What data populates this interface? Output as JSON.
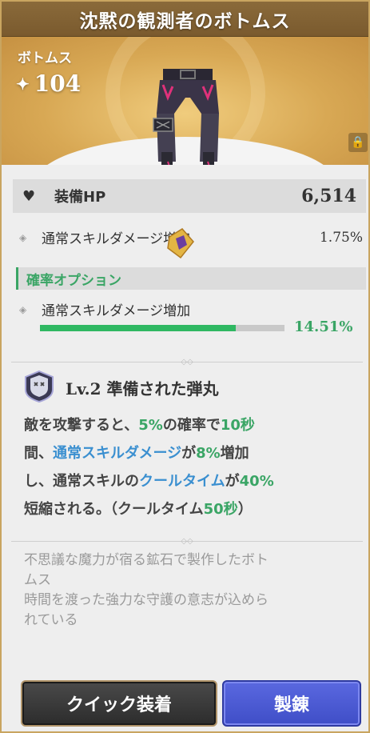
{
  "title": "沈黙の観測者のボトムス",
  "hero": {
    "item_type": "ボトムス",
    "level_icon": "sparkle-icon",
    "level": "104",
    "lock_icon": "lock-icon"
  },
  "main_stat": {
    "icon": "heart-icon",
    "label": "装備HP",
    "value": "6,514"
  },
  "sub_stat": {
    "label": "通常スキルダメージ増加",
    "value": "1.75%"
  },
  "probability_option": {
    "header": "確率オプション",
    "label": "通常スキルダメージ増加",
    "value": "14.51%",
    "bar_fill_fraction": 0.8,
    "bar_color": "#2fb862"
  },
  "skill": {
    "title": "Lv.2 準備された弾丸",
    "desc": {
      "l1a": "敵を攻撃すると、",
      "l1b": "5%",
      "l1c": "の確率で",
      "l1d": "10秒",
      "l2a": "間、",
      "l2b": "通常スキルダメージ",
      "l2c": "が",
      "l2d": "8%",
      "l2e": "増加",
      "l3a": "し、通常スキルの",
      "l3b": "クールタイム",
      "l3c": "が",
      "l3d": "40%",
      "l4a": "短縮される。（クールタイム",
      "l4b": "50秒",
      "l4c": "）"
    }
  },
  "flavor": {
    "line1": "不思議な魔力が宿る鉱石で製作したボト",
    "line2": "ムス",
    "line3": "時間を渡った強力な守護の意志が込めら",
    "line4": "れている"
  },
  "buttons": {
    "quick_equip": "クイック装着",
    "forge": "製錬"
  },
  "colors": {
    "accent_green": "#3aa565",
    "accent_blue": "#3a8fd0",
    "title_bg": "#7a5a2e",
    "hero_gold": "#d8a854",
    "forge_button": "#3f4ec7"
  }
}
